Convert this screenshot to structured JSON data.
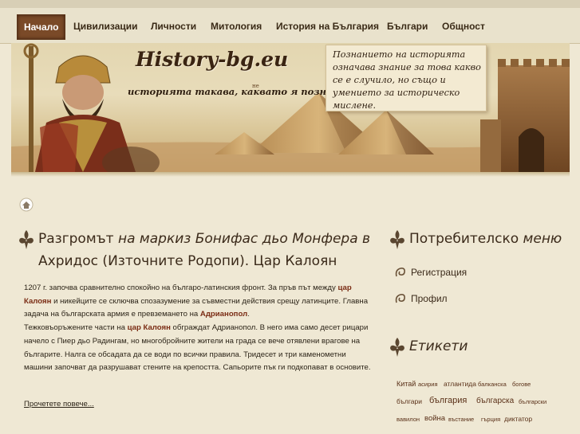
{
  "nav": {
    "items": [
      {
        "label": "Начало",
        "active": true
      },
      {
        "label": "Цивилизации"
      },
      {
        "label": "Личности"
      },
      {
        "label": "Митология"
      },
      {
        "label": "История на България"
      },
      {
        "label": "Българи"
      },
      {
        "label": "Общност"
      }
    ]
  },
  "banner": {
    "site_title": "History-bg.eu",
    "tagline": "историята такава, каквато я познаваме !",
    "tagline_superscript": "не",
    "quote": "Познанието на историята означава знание за това какво се е случило, но също и умението за историческо мислене."
  },
  "post": {
    "title_plain": "Разгромът",
    "title_italic": "на маркиз Бонифас дьо Монфера в",
    "title_line2": "Ахридос (Източните Родопи). Цар Калоян",
    "body": {
      "p1_a": "1207 г. започва сравнително спокойно на българо-латинския фронт. За пръв път между ",
      "p1_b": "цар Калоян",
      "p1_c": " и никейците се сключва спозазумение за съвместни действия срещу латинците. Главна задача на българската армия е превземането на ",
      "p1_d": "Адрианопол",
      "p1_e": ".",
      "p2_a": "Тежковъоръжените части на ",
      "p2_b": "цар Калоян",
      "p2_c": " обграждат Адрианопол. В него има само десет рицари начело с Пиер дьо Радингам, но многобройните жители на града се вече отявлени врагове на българите. Налга се обсадата да се води по всички правила. Тридесет и три каменометни машини започват да разрушават стените на крепостта. Сапьорите пък ги подкопават в основите."
    },
    "read_more": "Прочетете повече..."
  },
  "sidebar": {
    "user_menu": {
      "title_plain": "Потребителско",
      "title_italic": "меню",
      "links": [
        "Регистрация",
        "Профил"
      ]
    },
    "tags": {
      "title": "Етикети",
      "items": [
        "Китай",
        "асирия",
        "атлантида",
        "балканска",
        "богове",
        "българи",
        "българия",
        "българска",
        "български",
        "вавилон",
        "война",
        "въстание",
        "гърция",
        "диктатор"
      ]
    }
  },
  "colors": {
    "background": "#efe8d4",
    "nav_active": "#7a4a28",
    "highlight": "#7a2c14"
  }
}
